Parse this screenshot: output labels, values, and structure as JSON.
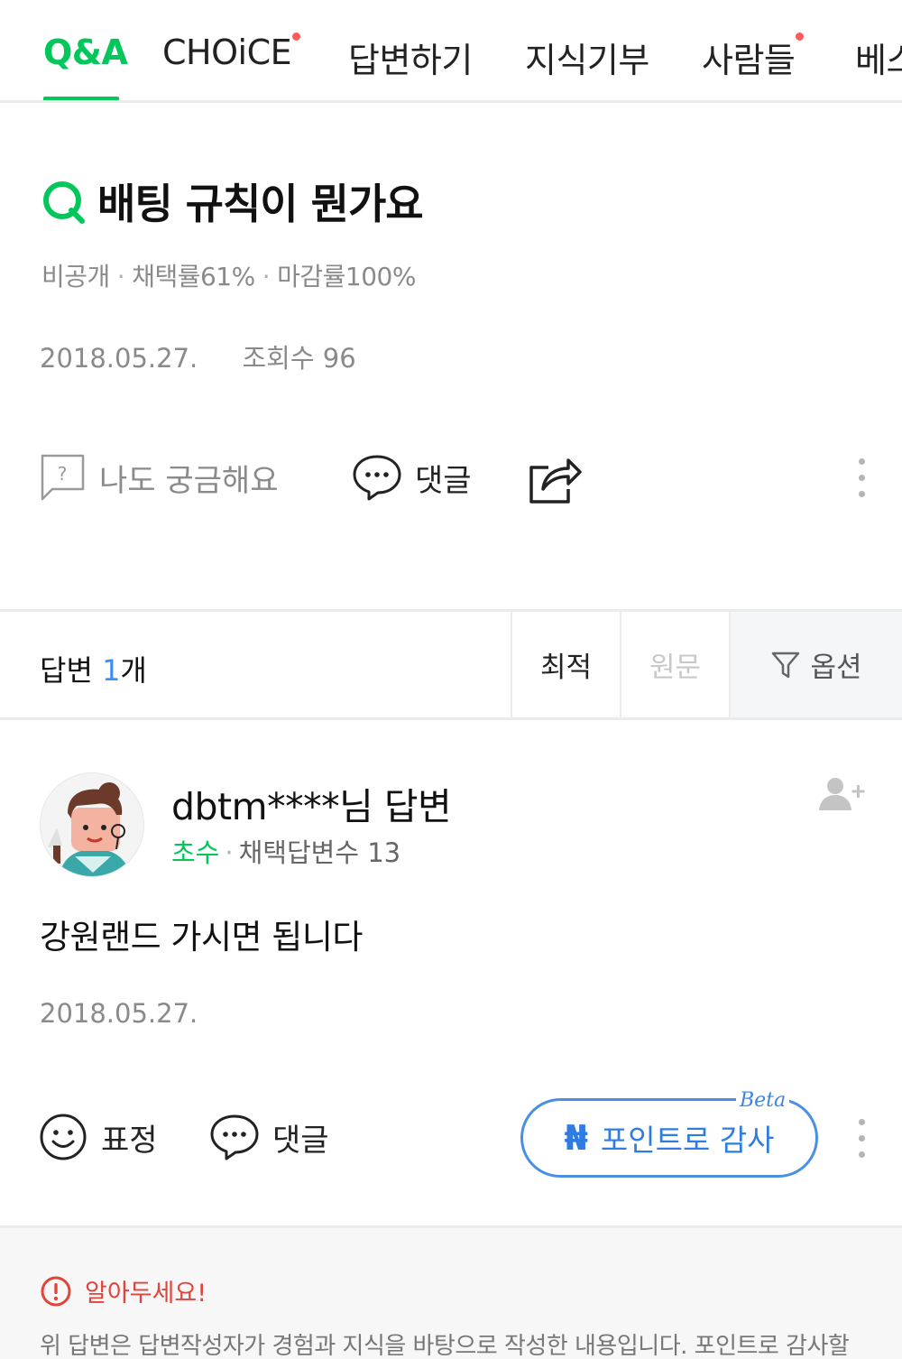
{
  "tabs": [
    {
      "label": "Q&A",
      "active": true,
      "has_dot": false
    },
    {
      "label": "CHOiCE",
      "active": false,
      "has_dot": true
    },
    {
      "label": "답변하기",
      "active": false,
      "has_dot": false
    },
    {
      "label": "지식기부",
      "active": false,
      "has_dot": false
    },
    {
      "label": "사람들",
      "active": false,
      "has_dot": true
    },
    {
      "label": "베스트",
      "active": false,
      "has_dot": false
    }
  ],
  "question": {
    "title": "배팅 규칙이 뭔가요",
    "privacy": "비공개",
    "adoption_rate": "채택률61%",
    "close_rate": "마감률100%",
    "date": "2018.05.27.",
    "views": "조회수 96",
    "actions": {
      "curious": "나도 궁금해요",
      "comment": "댓글"
    }
  },
  "answers_bar": {
    "label": "답변 ",
    "count": "1",
    "unit": "개",
    "sort_best": "최적",
    "sort_original": "원문",
    "option": "옵션"
  },
  "answer": {
    "author": "dbtm****님 답변",
    "rank": "초수",
    "adopted_count": "채택답변수 13",
    "body": "강원랜드 가시면 됩니다",
    "date": "2018.05.27.",
    "actions": {
      "emote": "표정",
      "comment": "댓글",
      "thank": "포인트로 감사",
      "beta": "Beta"
    }
  },
  "notice": {
    "title": "알아두세요!",
    "body": "위 답변은 답변작성자가 경험과 지식을 바탕으로 작성한 내용입니다. 포인트로 감사할"
  },
  "colors": {
    "accent_green": "#03c75a",
    "link_blue": "#2f7de1",
    "notice_red": "#e2433a"
  }
}
